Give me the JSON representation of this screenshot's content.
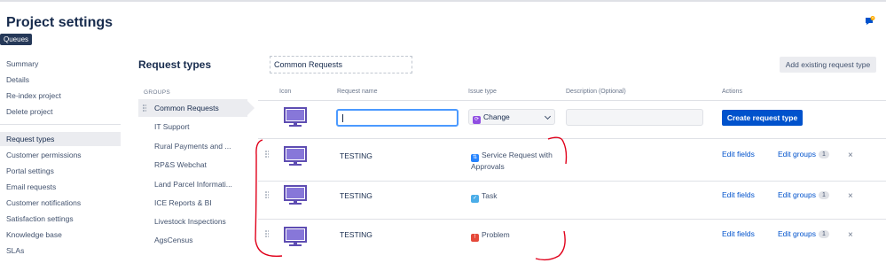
{
  "header": {
    "title": "Project settings",
    "tooltip": "Queues",
    "feedback_icon": "feedback-icon"
  },
  "sidebar": {
    "items": [
      {
        "label": "Summary",
        "active": false
      },
      {
        "label": "Details",
        "active": false
      },
      {
        "label": "Re-index project",
        "active": false
      },
      {
        "label": "Delete project",
        "active": false
      },
      {
        "label": "Request types",
        "active": true
      },
      {
        "label": "Customer permissions",
        "active": false
      },
      {
        "label": "Portal settings",
        "active": false
      },
      {
        "label": "Email requests",
        "active": false
      },
      {
        "label": "Customer notifications",
        "active": false
      },
      {
        "label": "Satisfaction settings",
        "active": false
      },
      {
        "label": "Knowledge base",
        "active": false
      },
      {
        "label": "SLAs",
        "active": false
      }
    ]
  },
  "main": {
    "title": "Request types",
    "group_name_value": "Common Requests",
    "add_existing_label": "Add existing request type",
    "groups_header": "GROUPS",
    "groups": [
      {
        "label": "Common Requests",
        "active": true
      },
      {
        "label": "IT Support",
        "active": false
      },
      {
        "label": "Rural Payments and ...",
        "active": false
      },
      {
        "label": "RP&S Webchat",
        "active": false
      },
      {
        "label": "Land Parcel Informati...",
        "active": false
      },
      {
        "label": "ICE Reports & BI",
        "active": false
      },
      {
        "label": "Livestock Inspections",
        "active": false
      },
      {
        "label": "AgsCensus",
        "active": false
      }
    ]
  },
  "table": {
    "headers": {
      "icon": "Icon",
      "request_name": "Request name",
      "issue_type": "Issue type",
      "description": "Description (Optional)",
      "actions": "Actions"
    },
    "new_row": {
      "name_value": "",
      "issue_type_selected": "Change",
      "issue_type_color": "#904ee2",
      "description_value": "",
      "create_label": "Create request type"
    },
    "rows": [
      {
        "name": "TESTING",
        "issue_line1": "Service Request with",
        "issue_line2": "Approvals",
        "issue_color": "#2684ff",
        "edit_fields": "Edit fields",
        "edit_groups": "Edit groups",
        "group_count": "1",
        "delete": "×"
      },
      {
        "name": "TESTING",
        "issue_line1": "Task",
        "issue_line2": "",
        "issue_color": "#4bade8",
        "edit_fields": "Edit fields",
        "edit_groups": "Edit groups",
        "group_count": "1",
        "delete": "×"
      },
      {
        "name": "TESTING",
        "issue_line1": "Problem",
        "issue_line2": "",
        "issue_color": "#e5493a",
        "edit_fields": "Edit fields",
        "edit_groups": "Edit groups",
        "group_count": "1",
        "delete": "×"
      }
    ],
    "icon_name": "monitor-icon",
    "icon_color": "#5e4db2"
  },
  "colors": {
    "accent": "#0052cc",
    "annotation": "#e0001a"
  }
}
